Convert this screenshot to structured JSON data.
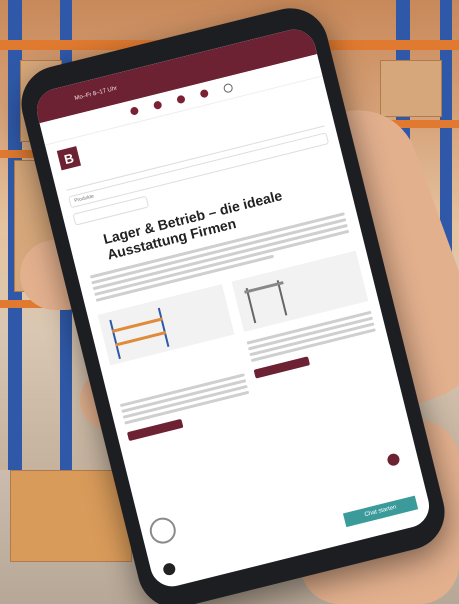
{
  "site": {
    "topbar_line1": "Mo–Fr 8–17 Uhr",
    "topbar_line2": "",
    "logo_letter": "B",
    "logo_text": "",
    "nav_label": "Produkte",
    "headline": "Lager & Betrieb – die ideale Ausstattung Firmen",
    "chat_label": "Chat starten"
  },
  "colors": {
    "brand": "#6d2233",
    "chat": "#3a9b9a",
    "rack_blue": "#2f59a8",
    "rack_orange": "#e07a30"
  }
}
